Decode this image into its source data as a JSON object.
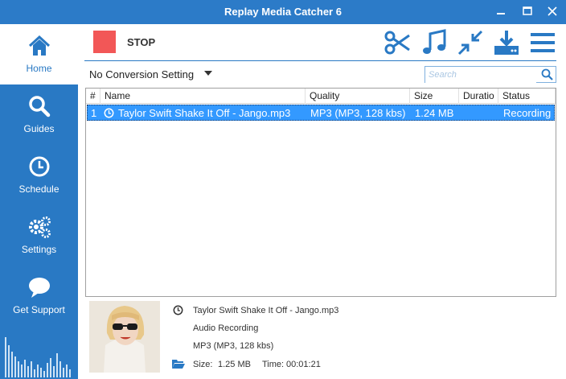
{
  "window": {
    "title": "Replay Media Catcher 6"
  },
  "sidebar": {
    "items": [
      {
        "label": "Home"
      },
      {
        "label": "Guides"
      },
      {
        "label": "Schedule"
      },
      {
        "label": "Settings"
      },
      {
        "label": "Get Support"
      }
    ]
  },
  "toolbar": {
    "stop_label": "STOP"
  },
  "conversion": {
    "selected": "No Conversion Setting"
  },
  "search": {
    "placeholder": "Search"
  },
  "table": {
    "headers": [
      "#",
      "Name",
      "Quality",
      "Size",
      "Duratio",
      "Status"
    ],
    "rows": [
      {
        "num": "1",
        "name": "Taylor Swift Shake It Off - Jango.mp3",
        "quality": "MP3  (MP3, 128 kbs)",
        "size": "1.24 MB",
        "duration": "",
        "status": "Recording"
      }
    ]
  },
  "detail": {
    "filename": "Taylor Swift Shake It Off - Jango.mp3",
    "type": "Audio Recording",
    "format": "MP3  (MP3, 128 kbs)",
    "size_label": "Size:",
    "size_value": "1.25 MB",
    "time_label": "Time:",
    "time_value": "00:01:21"
  },
  "colors": {
    "accent": "#2979c4",
    "stop": "#f25757",
    "selection": "#3399ff"
  }
}
